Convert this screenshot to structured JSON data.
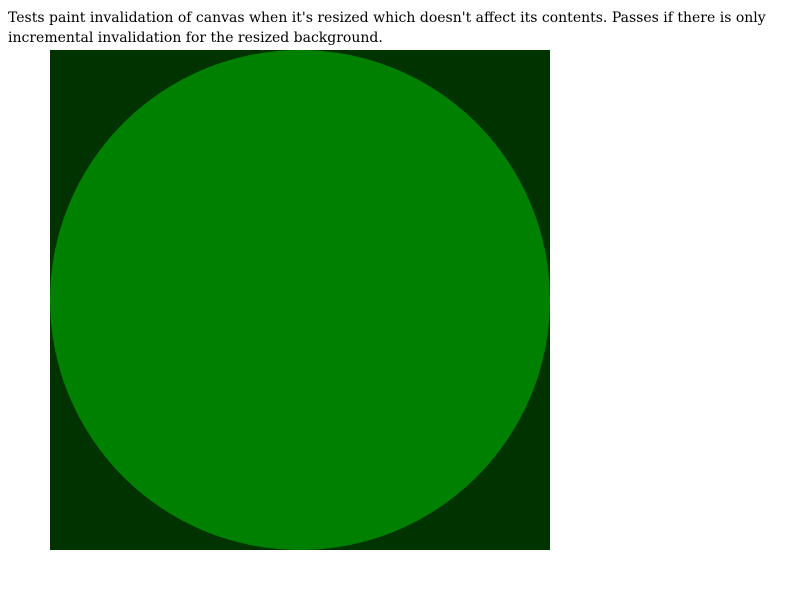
{
  "description": {
    "text": "Tests paint invalidation of canvas when it's resized which doesn't affect its contents. Passes if there is only incremental invalidation for the resized background."
  },
  "canvas": {
    "background_color": "#003300",
    "circle_color": "#008000"
  }
}
